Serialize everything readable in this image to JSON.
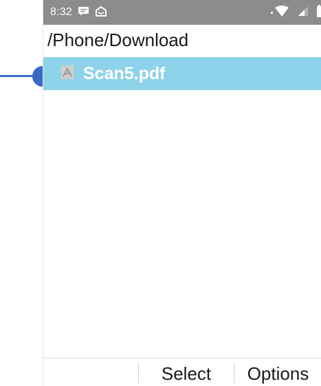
{
  "status_bar": {
    "time": "8:32",
    "icons_left": [
      "message-icon",
      "notification-icon"
    ],
    "icons_right": [
      "wifi-icon",
      "signal-icon",
      "battery-icon"
    ]
  },
  "path": "/Phone/Download",
  "files": [
    {
      "name": "Scan5.pdf",
      "icon": "pdf-icon",
      "selected": true
    }
  ],
  "softkeys": {
    "left": "",
    "center": "Select",
    "right": "Options"
  },
  "colors": {
    "status_bar": "#8c8c8c",
    "selection": "#8fd3ea",
    "callout": "#3a6ac4"
  }
}
